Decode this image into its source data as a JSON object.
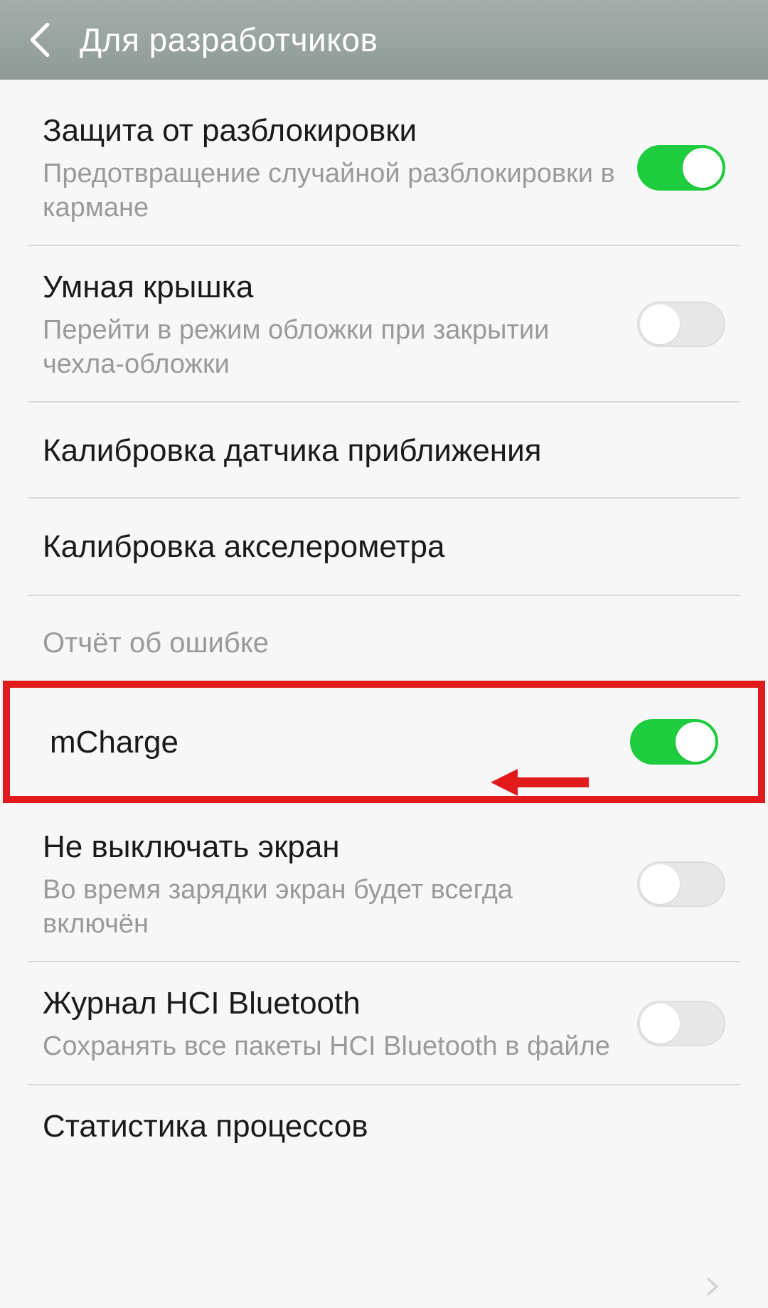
{
  "header": {
    "title": "Для разработчиков"
  },
  "rows": {
    "unlockProtection": {
      "title": "Защита от разблокировки",
      "sub": "Предотвращение случайной разблокировки в кармане"
    },
    "smartCover": {
      "title": "Умная крышка",
      "sub": "Перейти в режим обложки при закрытии чехла-обложки"
    },
    "proxCal": {
      "title": "Калибровка датчика приближения"
    },
    "accelCal": {
      "title": "Калибровка акселерометра"
    },
    "bugReportHeader": "Отчёт об ошибке",
    "mcharge": {
      "title": "mCharge"
    },
    "stayAwake": {
      "title": "Не выключать экран",
      "sub": "Во время зарядки экран будет всегда включён"
    },
    "btHci": {
      "title": "Журнал HCI Bluetooth",
      "sub": "Сохранять все пакеты HCI Bluetooth в файле"
    },
    "procStats": {
      "title": "Статистика процессов"
    }
  },
  "toggles": {
    "unlockProtection": true,
    "smartCover": false,
    "mcharge": true,
    "stayAwake": false,
    "btHci": false
  },
  "colors": {
    "accent": "#1ecd3f",
    "highlight": "#e11b1b"
  }
}
